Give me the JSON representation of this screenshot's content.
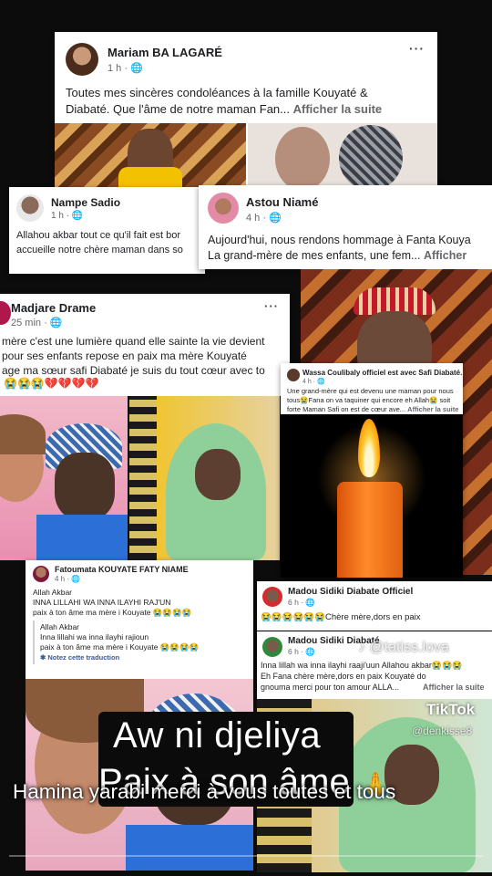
{
  "posts": {
    "mariam": {
      "name": "Mariam BA LAGARÉ",
      "time": "1 h ·",
      "line1": "Toutes mes sincères condoléances à la famille Kouyaté &",
      "line2": "Diabaté. Que l'âme de notre maman Fan...",
      "more": "Afficher la suite"
    },
    "nampe": {
      "name": "Nampe Sadio",
      "time": "1 h ·",
      "line1": "Allahou akbar tout ce qu'il fait est bor",
      "line2": "accueille notre chère maman dans so"
    },
    "astou": {
      "name": "Astou Niamé",
      "time": "4 h ·",
      "line1": "Aujourd'hui, nous rendons hommage à Fanta Kouya",
      "line2": "La grand-mère de mes enfants, une fem...",
      "more": "Afficher"
    },
    "madjare": {
      "name": "Madjare Drame",
      "time": "25 min ·",
      "line1": "mère c'est une lumière quand elle sainte la vie devient",
      "line2": "pour ses enfants repose en paix ma mère Kouyaté",
      "line3": "age ma sœur safi Diabaté je suis du tout cœur avec to",
      "emojis": "😭😭😭💔💔💔💔"
    },
    "wassa": {
      "name": "Wassa Coulibaly officiel est avec Safi Diabaté.",
      "time": "4 h ·",
      "line1": "Une grand-mère qui est devenu une maman pour nous",
      "line2": "tous😭Fana on va taquiner qui encore eh Allah😭 soit",
      "line3": "forte Maman Safi on est de cœur ave...",
      "more": "Afficher la suite"
    },
    "fatoumata": {
      "name": "Fatoumata KOUYATE FATY NIAME",
      "time": "4 h ·",
      "line1": "Allah Akbar",
      "line2": "INNA LILLAHI WA INNA ILAYHI RAJ'UN",
      "line3": "paix à ton âme ma mère i Kouyate 😭😭😭😭",
      "tr1": "Allah Akbar",
      "tr2": "Inna lillahi wa inna ilayhi rajioun",
      "tr3": "paix à ton âme ma mère i Kouyate 😭😭😭😭",
      "rate": "Notez cette traduction"
    },
    "madou1": {
      "name": "Madou Sidiki Diabate Officiel",
      "time": "6 h ·",
      "line1": "😭😭😭😭😭😭Chère mère,dors en paix"
    },
    "madou2": {
      "name": "Madou Sidiki Diabaté",
      "time": "6 h ·",
      "line1": "Inna lillah wa inna ilayhi raaji'uun Allahou akbar😭😭😭",
      "line2": "Eh Fana chère mère,dors en paix Kouyaté do",
      "line3": "gnouma merci pour ton amour ALLA...",
      "more": "Afficher la suite"
    }
  },
  "overlay": {
    "watermark": "@tatiss.lova",
    "tiktok": "TikTok",
    "tiktok_user": "@denkisse8",
    "caption_line1": "Aw ni djeliya",
    "caption_line2": "Paix à son âme",
    "subtitle": "Hamina yarabi merci à vous toutes et tous",
    "pray_emoji": "🙏"
  },
  "colors": {
    "card_bg": "#ffffff",
    "page_bg": "#0c0c0c",
    "secondary_text": "#65676b",
    "flame": "#ffcc33",
    "candle": "#ff7a1a"
  },
  "icons": [
    "globe-icon",
    "more-options-icon",
    "translate-icon",
    "music-note-icon",
    "tiktok-logo-icon"
  ]
}
